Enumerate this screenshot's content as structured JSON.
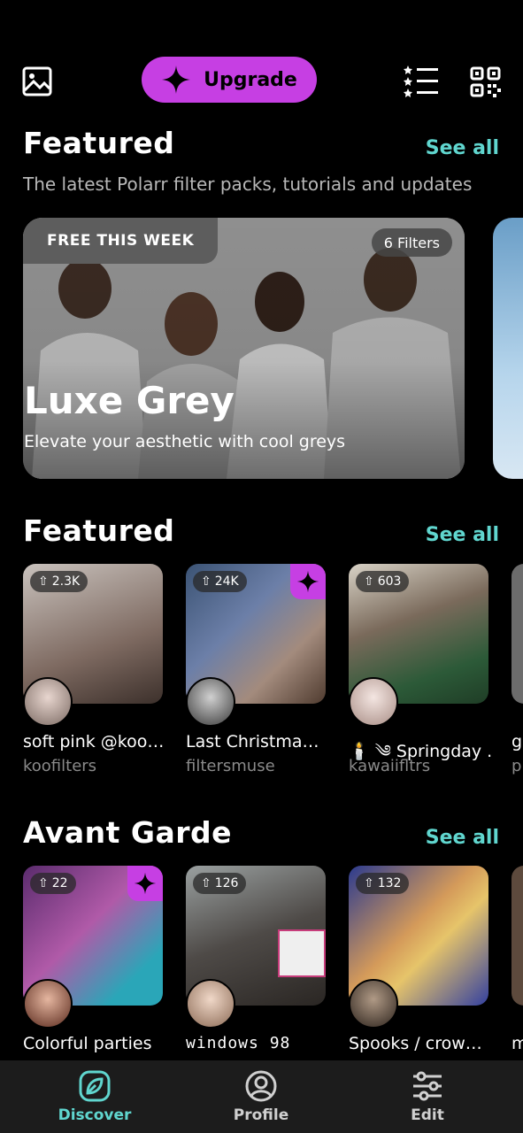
{
  "topbar": {
    "gallery_icon": "image-icon",
    "upgrade_label": "Upgrade",
    "list_icon": "starred-list-icon",
    "qr_icon": "qr-code-icon"
  },
  "featured_packs": {
    "title": "Featured",
    "see_all": "See all",
    "subtitle": "The latest Polarr filter packs, tutorials and updates",
    "hero": {
      "tag": "FREE THIS WEEK",
      "filters": "6 Filters",
      "title": "Luxe Grey",
      "subtitle": "Elevate your aesthetic with cool greys"
    }
  },
  "featured_filters": {
    "title": "Featured",
    "see_all": "See all",
    "items": [
      {
        "count": "2.3K",
        "title": "soft pink @koo…",
        "author": "koofilters",
        "premium": false
      },
      {
        "count": "24K",
        "title": "Last Christma…",
        "author": "filtersmuse",
        "premium": true
      },
      {
        "count": "603",
        "title": "🕯️ ༄ Springday .",
        "author": "kawaiifltrs",
        "premium": false
      },
      {
        "title_peek": "g",
        "author_peek": "p"
      }
    ]
  },
  "avant_garde": {
    "title": "Avant Garde",
    "see_all": "See all",
    "items": [
      {
        "count": "22",
        "title": "Colorful parties",
        "premium": true
      },
      {
        "count": "126",
        "title": "windows 98",
        "premium": false
      },
      {
        "count": "132",
        "title": "Spooks / crow…",
        "premium": false
      },
      {
        "title_peek": "m"
      }
    ]
  },
  "bottom_nav": {
    "discover": "Discover",
    "profile": "Profile",
    "edit": "Edit"
  },
  "colors": {
    "accent_purple": "#c63fe3",
    "accent_teal": "#60d6cf",
    "nav_bg": "#1c1c1c"
  }
}
